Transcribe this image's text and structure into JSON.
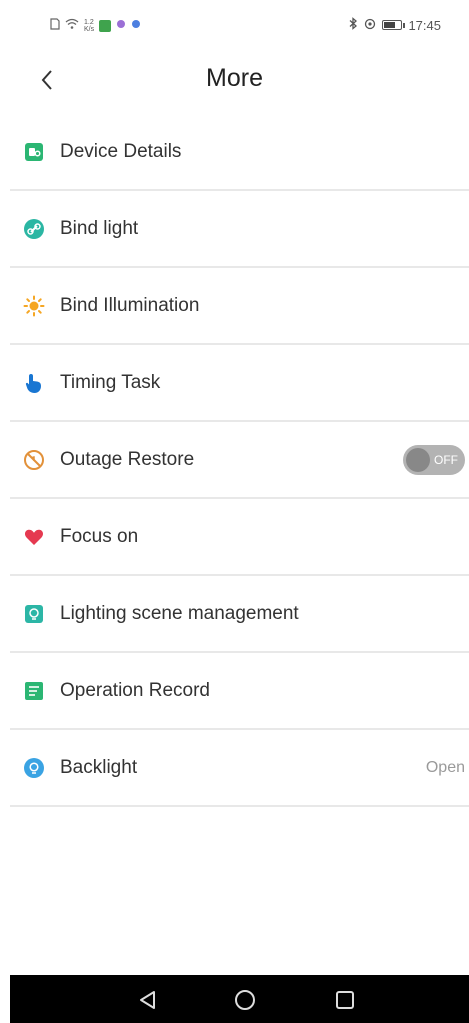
{
  "status_bar": {
    "net_speed_value": "1.2",
    "net_speed_unit": "K/s",
    "time": "17:45"
  },
  "header": {
    "title": "More"
  },
  "menu": {
    "items": [
      {
        "label": "Device Details",
        "icon": "device-details-icon"
      },
      {
        "label": "Bind light",
        "icon": "link-icon"
      },
      {
        "label": "Bind Illumination",
        "icon": "sun-icon"
      },
      {
        "label": "Timing Task",
        "icon": "pointing-hand-icon"
      },
      {
        "label": "Outage Restore",
        "icon": "power-off-icon",
        "toggle_text": "OFF",
        "toggle_on": false
      },
      {
        "label": "Focus on",
        "icon": "heart-icon"
      },
      {
        "label": "Lighting scene management",
        "icon": "scene-icon"
      },
      {
        "label": "Operation Record",
        "icon": "record-icon"
      },
      {
        "label": "Backlight",
        "icon": "lightbulb-icon",
        "value": "Open"
      }
    ]
  },
  "colors": {
    "green": "#2bb673",
    "orange": "#f5a623",
    "blue": "#1976d2",
    "red": "#e53950",
    "teal": "#2cb6a6",
    "light_blue": "#3aa3e3",
    "toggle_off": "#b3b3b3"
  }
}
